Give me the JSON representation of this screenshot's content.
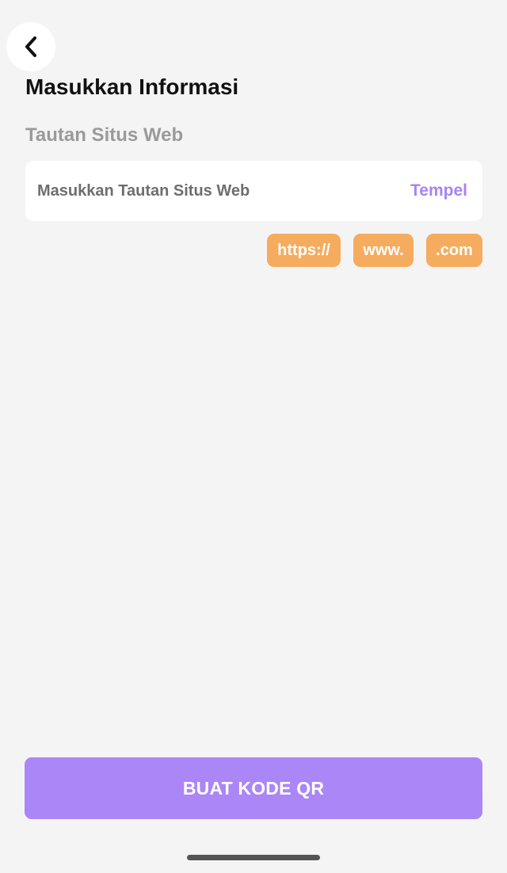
{
  "header": {
    "back_icon": "chevron-left-icon",
    "title": "Masukkan Informasi"
  },
  "form": {
    "section_label": "Tautan Situs Web",
    "url_input": {
      "value": "",
      "placeholder": "Masukkan Tautan Situs Web"
    },
    "paste_label": "Tempel",
    "chips": [
      {
        "label": "https://"
      },
      {
        "label": "www."
      },
      {
        "label": ".com"
      }
    ]
  },
  "footer": {
    "generate_label": "BUAT KODE QR"
  },
  "colors": {
    "background": "#f5f4f5",
    "accent_purple": "#ab86f6",
    "paste_text": "#a784f3",
    "chip_orange": "#f5ac5f"
  }
}
